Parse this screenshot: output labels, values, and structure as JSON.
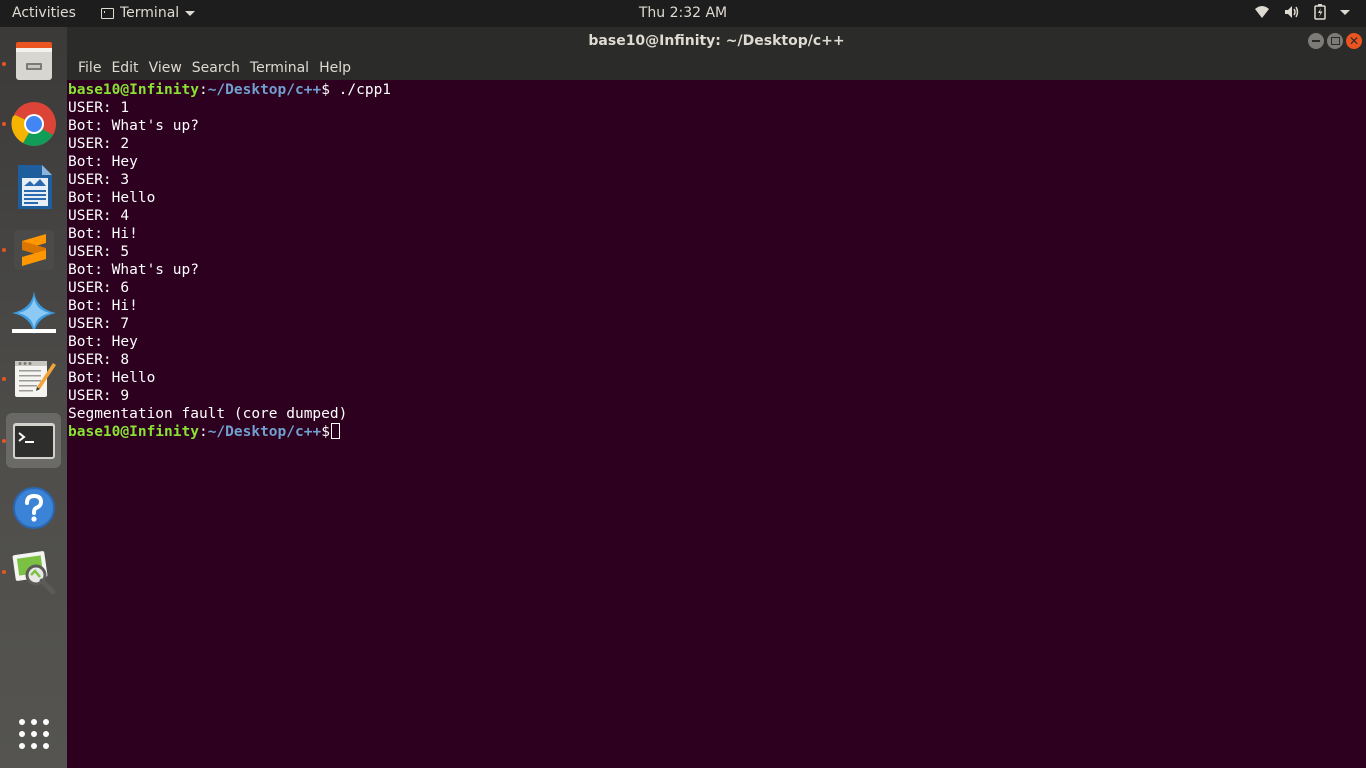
{
  "top_panel": {
    "activities": "Activities",
    "app_menu_label": "Terminal",
    "clock": "Thu  2:32 AM"
  },
  "window": {
    "title": "base10@Infinity: ~/Desktop/c++"
  },
  "menu": [
    "File",
    "Edit",
    "View",
    "Search",
    "Terminal",
    "Help"
  ],
  "terminal": {
    "prompt_user": "base10@Infinity",
    "prompt_path": "~/Desktop/c++",
    "prompt_symbol": "$",
    "command": " ./cpp1",
    "output": [
      "USER: 1",
      "Bot: What's up?",
      "USER: 2",
      "Bot: Hey",
      "USER: 3",
      "Bot: Hello",
      "USER: 4",
      "Bot: Hi!",
      "USER: 5",
      "Bot: What's up?",
      "USER: 6",
      "Bot: Hi!",
      "USER: 7",
      "Bot: Hey",
      "USER: 8",
      "Bot: Hello",
      "USER: 9",
      "Segmentation fault (core dumped)"
    ]
  },
  "dock": [
    {
      "name": "file-cabinet-icon",
      "running": true
    },
    {
      "name": "chrome-icon",
      "running": true
    },
    {
      "name": "writer-document-icon",
      "running": false
    },
    {
      "name": "sublime-text-icon",
      "running": true
    },
    {
      "name": "star-app-icon",
      "running": false
    },
    {
      "name": "text-editor-icon",
      "running": true
    },
    {
      "name": "terminal-icon",
      "running": true
    },
    {
      "name": "help-icon",
      "running": false
    },
    {
      "name": "image-viewer-icon",
      "running": true
    },
    {
      "name": "show-applications-icon",
      "running": false
    }
  ],
  "colors": {
    "terminal_bg": "#2c001e",
    "prompt_user": "#8ae234",
    "prompt_path": "#729fcf",
    "accent": "#e95420"
  }
}
